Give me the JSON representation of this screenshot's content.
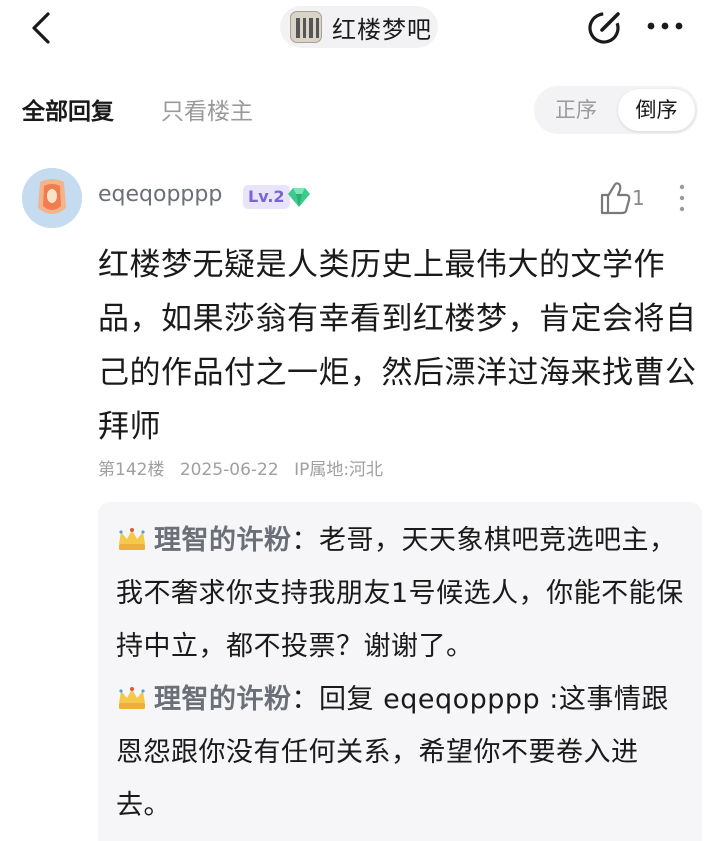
{
  "header": {
    "forum_name": "红楼梦吧",
    "back_icon": "chevron-left-icon",
    "edit_icon": "edit-icon",
    "more_icon": "more-icon"
  },
  "filters": {
    "all_replies": "全部回复",
    "op_only": "只看楼主",
    "order_asc": "正序",
    "order_desc": "倒序",
    "selected_order": "倒序"
  },
  "post": {
    "username": "eqeqopppp",
    "level": "Lv.2",
    "like_count": "1",
    "content": "红楼梦无疑是人类历史上最伟大的文学作品，如果莎翁有幸看到红楼梦，肯定会将自己的作品付之一炬，然后漂洋过海来找曹公拜师",
    "floor": "第142楼",
    "date": "2025-06-22",
    "ip": "IP属地:河北"
  },
  "sub_replies": [
    {
      "author": "理智的许粉",
      "separator": "：",
      "text": "老哥，天天象棋吧竞选吧主，我不奢求你支持我朋友1号候选人，你能不能保持中立，都不投票？谢谢了。"
    },
    {
      "author": "理智的许粉",
      "separator": "：",
      "reply_prefix": "回复 ",
      "mention": "eqeqopppp",
      "text": " :这事情跟恩怨跟你没有任何关系，希望你不要卷入进去。"
    }
  ],
  "colors": {
    "accent_level": "#7a64d6",
    "username": "#6b6f78",
    "meta": "#a0a0a0",
    "subreply_bg": "#f6f6f8"
  }
}
